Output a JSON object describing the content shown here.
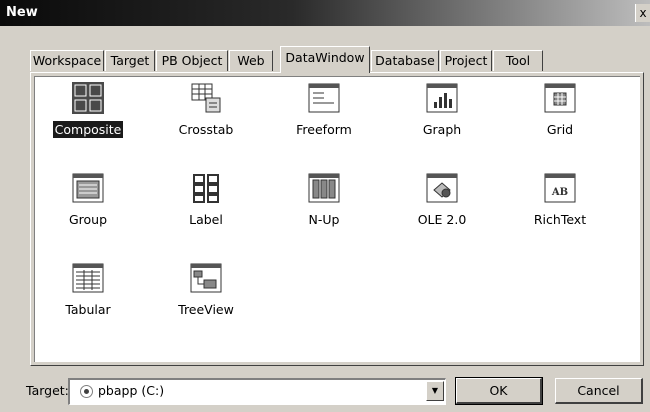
{
  "window": {
    "title": "New",
    "close_glyph": "x"
  },
  "tabs": [
    {
      "label": "Workspace",
      "active": false
    },
    {
      "label": "Target",
      "active": false
    },
    {
      "label": "PB Object",
      "active": false
    },
    {
      "label": "Web",
      "active": false
    },
    {
      "label": "DataWindow",
      "active": true
    },
    {
      "label": "Database",
      "active": false
    },
    {
      "label": "Project",
      "active": false
    },
    {
      "label": "Tool",
      "active": false
    }
  ],
  "items": [
    {
      "label": "Composite",
      "icon": "composite-icon",
      "selected": true
    },
    {
      "label": "Crosstab",
      "icon": "crosstab-icon",
      "selected": false
    },
    {
      "label": "Freeform",
      "icon": "freeform-icon",
      "selected": false
    },
    {
      "label": "Graph",
      "icon": "graph-icon",
      "selected": false
    },
    {
      "label": "Grid",
      "icon": "grid-icon",
      "selected": false
    },
    {
      "label": "Group",
      "icon": "group-icon",
      "selected": false
    },
    {
      "label": "Label",
      "icon": "label-icon",
      "selected": false
    },
    {
      "label": "N-Up",
      "icon": "n-up-icon",
      "selected": false
    },
    {
      "label": "OLE 2.0",
      "icon": "ole-icon",
      "selected": false
    },
    {
      "label": "RichText",
      "icon": "richtext-icon",
      "selected": false
    },
    {
      "label": "Tabular",
      "icon": "tabular-icon",
      "selected": false
    },
    {
      "label": "TreeView",
      "icon": "treeview-icon",
      "selected": false
    }
  ],
  "richtext_icon_text": "AB",
  "target": {
    "label": "Target:",
    "value": "pbapp (C:)"
  },
  "buttons": {
    "ok": "OK",
    "cancel": "Cancel"
  }
}
